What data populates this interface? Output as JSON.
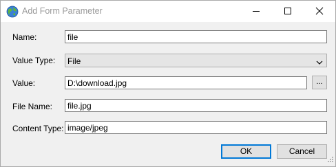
{
  "window": {
    "title": "Add Form Parameter"
  },
  "titlebar": {
    "icon": "globe-icon",
    "minimize_icon": "minimize-icon",
    "maximize_icon": "maximize-icon",
    "close_icon": "close-icon"
  },
  "form": {
    "name_label": "Name:",
    "name_value": "file",
    "value_type_label": "Value Type:",
    "value_type_selected": "File",
    "value_label": "Value:",
    "value_value": "D:\\download.jpg",
    "browse_label": "...",
    "file_name_label": "File Name:",
    "file_name_value": "file.jpg",
    "content_type_label": "Content Type:",
    "content_type_value": "image/jpeg"
  },
  "actions": {
    "ok_label": "OK",
    "cancel_label": "Cancel"
  },
  "colors": {
    "accent": "#0078d7",
    "window_bg": "#f0f0f0",
    "title_text": "#999999"
  }
}
